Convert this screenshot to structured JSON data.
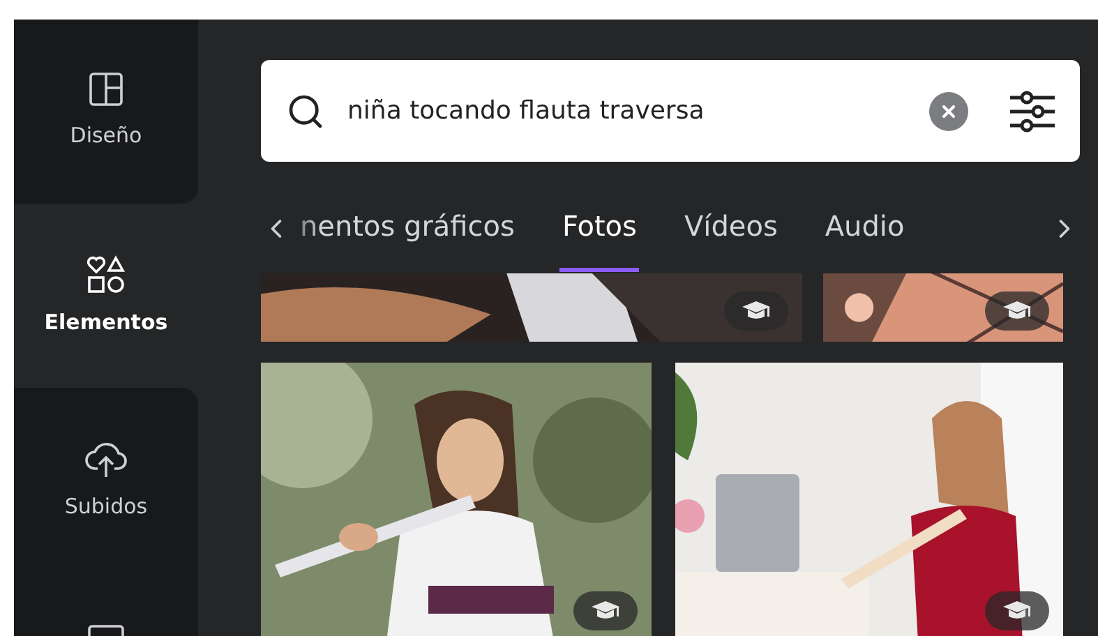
{
  "sidebar": {
    "items": [
      {
        "label": "Diseño",
        "selected": false
      },
      {
        "label": "Elementos",
        "selected": true
      },
      {
        "label": "Subidos",
        "selected": false
      },
      {
        "selected": false
      }
    ]
  },
  "search": {
    "value": "niña tocando flauta traversa"
  },
  "tabs": [
    {
      "label": "nentos gráficos",
      "selected": false
    },
    {
      "label": "Fotos",
      "selected": true
    },
    {
      "label": "Vídeos",
      "selected": false
    },
    {
      "label": "Audio",
      "selected": false
    }
  ]
}
